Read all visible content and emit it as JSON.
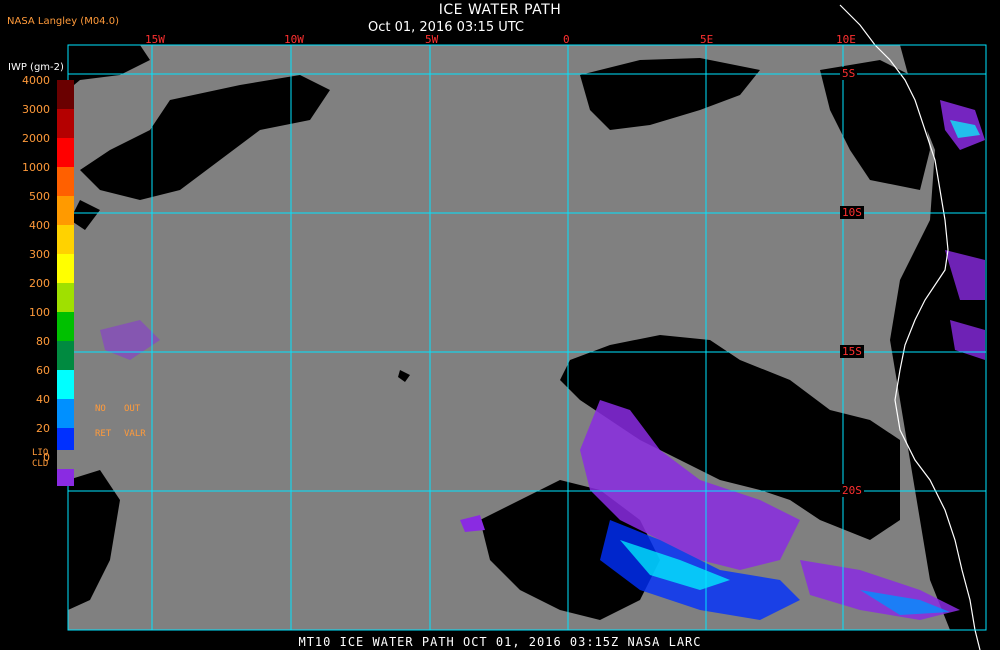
{
  "header": {
    "title": "ICE WATER PATH",
    "subtitle": "Oct 01, 2016 03:15 UTC",
    "source": "NASA Langley (M04.0)"
  },
  "legend": {
    "units": "IWP (gm-2)",
    "ticks": [
      "4000",
      "3000",
      "2000",
      "1000",
      "500",
      "400",
      "300",
      "200",
      "100",
      "80",
      "60",
      "40",
      "20",
      "0"
    ],
    "colors": [
      "#6a0000",
      "#b40000",
      "#ff0000",
      "#ff6000",
      "#ff9a00",
      "#ffd200",
      "#ffff00",
      "#a0e000",
      "#00c000",
      "#008a40",
      "#00ffff",
      "#0090ff",
      "#0030ff",
      "#8a2be2"
    ],
    "no_ret": {
      "no": "NO",
      "ret": "RET",
      "out": "OUT",
      "valr": "VALR"
    },
    "liq_cld": {
      "liq": "LIQ",
      "cld": "CLD",
      "color": "#808080"
    }
  },
  "grid": {
    "longitude_labels": [
      "15W",
      "10W",
      "5W",
      "0",
      "5E",
      "10E"
    ],
    "latitude_labels": [
      "5S",
      "10S",
      "15S",
      "20S"
    ]
  },
  "footer": {
    "text": "MT10  ICE WATER PATH  OCT 01, 2016 03:15Z  NASA LARC"
  },
  "colors": {
    "grid": "#00e5ff",
    "label": "#ff9a3a",
    "coord_label": "#ff3030",
    "liquid_cloud": "#808080",
    "clear": "#000000",
    "coast": "#ffffff"
  }
}
